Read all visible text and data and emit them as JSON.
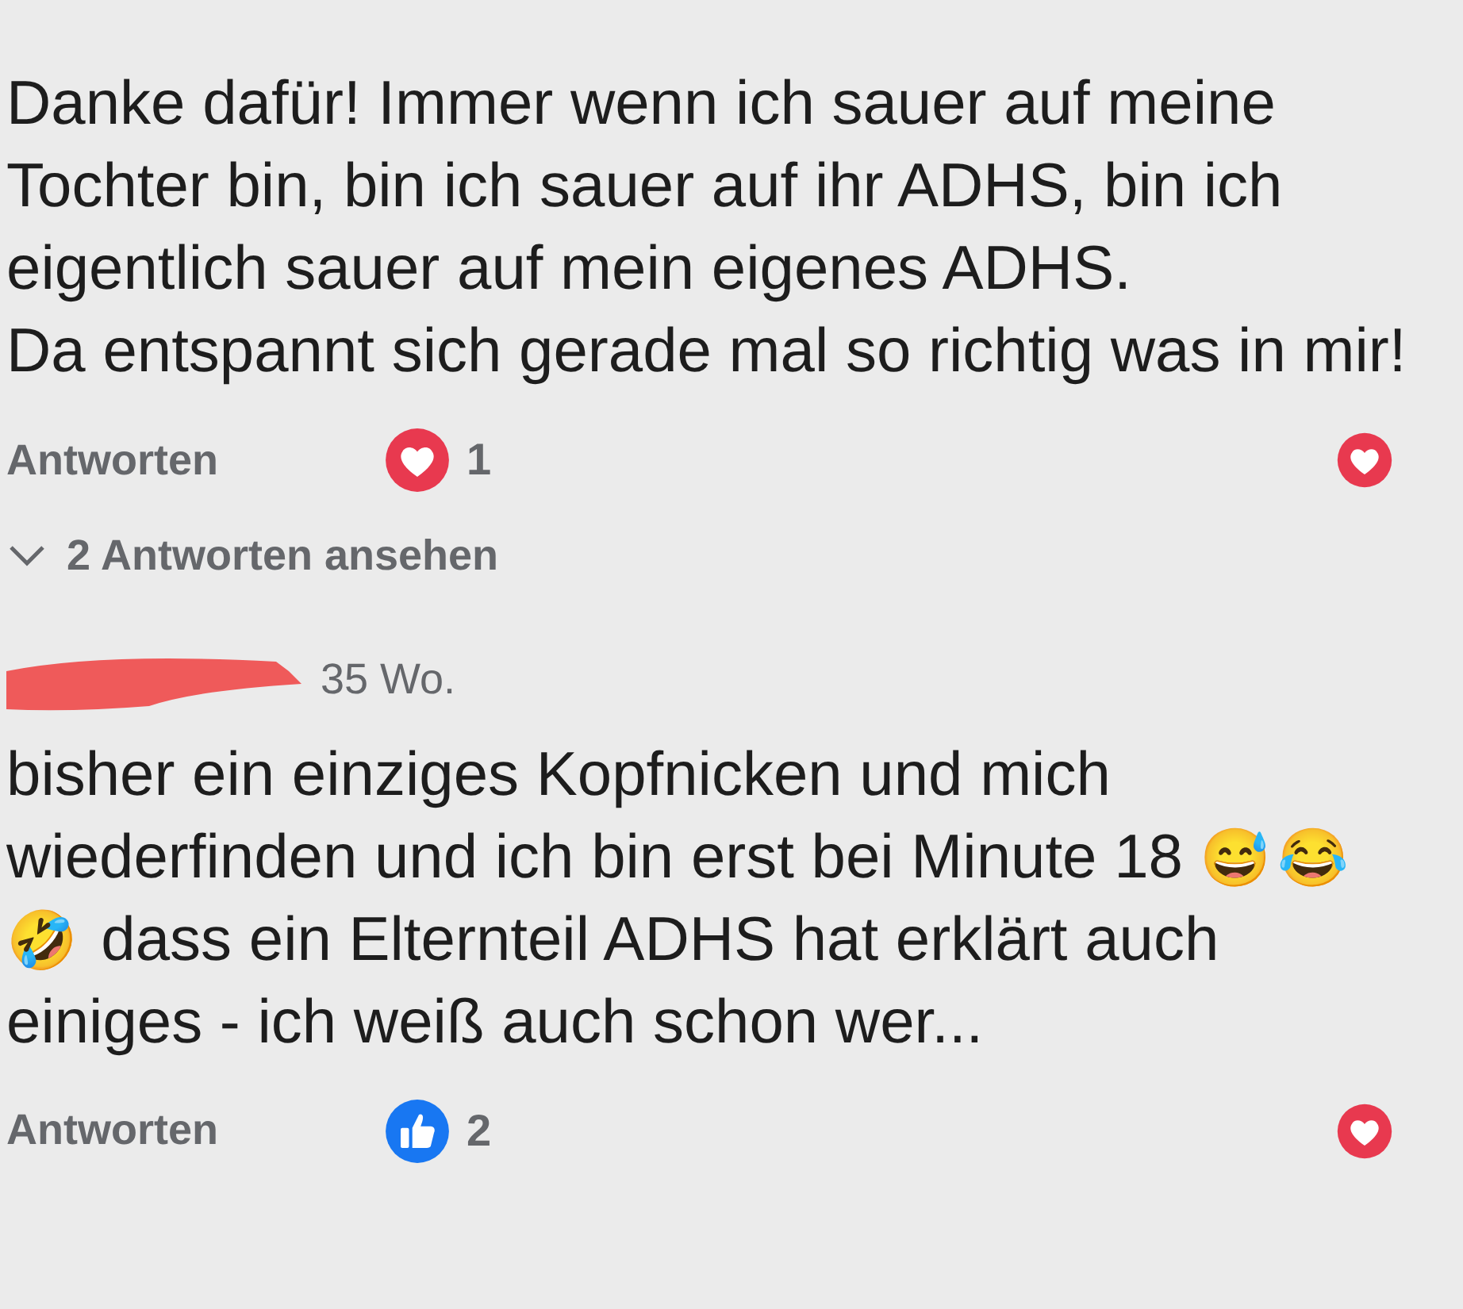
{
  "comments": [
    {
      "body": [
        {
          "kind": "text",
          "text": "Danke dafür! Immer wenn ich sauer auf meine Tochter bin, bin ich sauer auf ihr ADHS, bin ich eigentlich sauer auf mein eigenes ADHS.\nDa entspannt sich gerade mal so richtig was in mir!"
        }
      ],
      "reply_label": "Antworten",
      "reaction": {
        "kind": "love",
        "count": "1"
      },
      "replies_link": "2 Antworten ansehen"
    },
    {
      "author_hidden": true,
      "time": "35 Wo.",
      "body": [
        {
          "kind": "text",
          "text": "bisher ein einziges Kopfnicken und mich wiederfinden und ich bin erst bei Minute 18 "
        },
        {
          "kind": "emoji",
          "text": "😅"
        },
        {
          "kind": "emoji",
          "text": "😂"
        },
        {
          "kind": "emoji",
          "text": "🤣"
        },
        {
          "kind": "text",
          "text": " dass ein Elternteil ADHS hat erklärt auch einiges - ich weiß auch schon wer..."
        }
      ],
      "reply_label": "Antworten",
      "reaction": {
        "kind": "like",
        "count": "2"
      }
    }
  ]
}
